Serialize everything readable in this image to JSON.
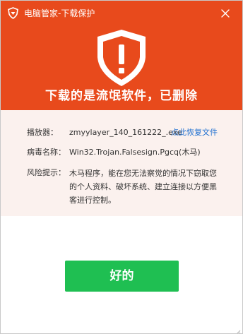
{
  "window": {
    "title": "电脑管家-下载保护"
  },
  "icons": {
    "logo": "tencent-pc-manager-shield-icon",
    "close": "close-icon",
    "warning": "warning-shield-icon"
  },
  "headline": "下载的是流氓软件，已删除",
  "details": {
    "player_label": "播放器：",
    "player_file": "zmyylayer_140_161222_.exe",
    "recover_link": "点此恢复文件",
    "virus_label": "病毒名称：",
    "virus_name": "Win32.Trojan.Falsesign.Pgcq(木马)",
    "risk_label": "风险提示：",
    "risk_text": "木马程序，能在您无法察觉的情况下窃取您的个人资料、破坏系统、建立连接以方便黑客进行控制。"
  },
  "buttons": {
    "ok_label": "好的"
  },
  "colors": {
    "header": "#e84a1c",
    "details_bg": "#fbf1ee",
    "link": "#1e6fd0",
    "ok_button": "#1fbf52"
  }
}
